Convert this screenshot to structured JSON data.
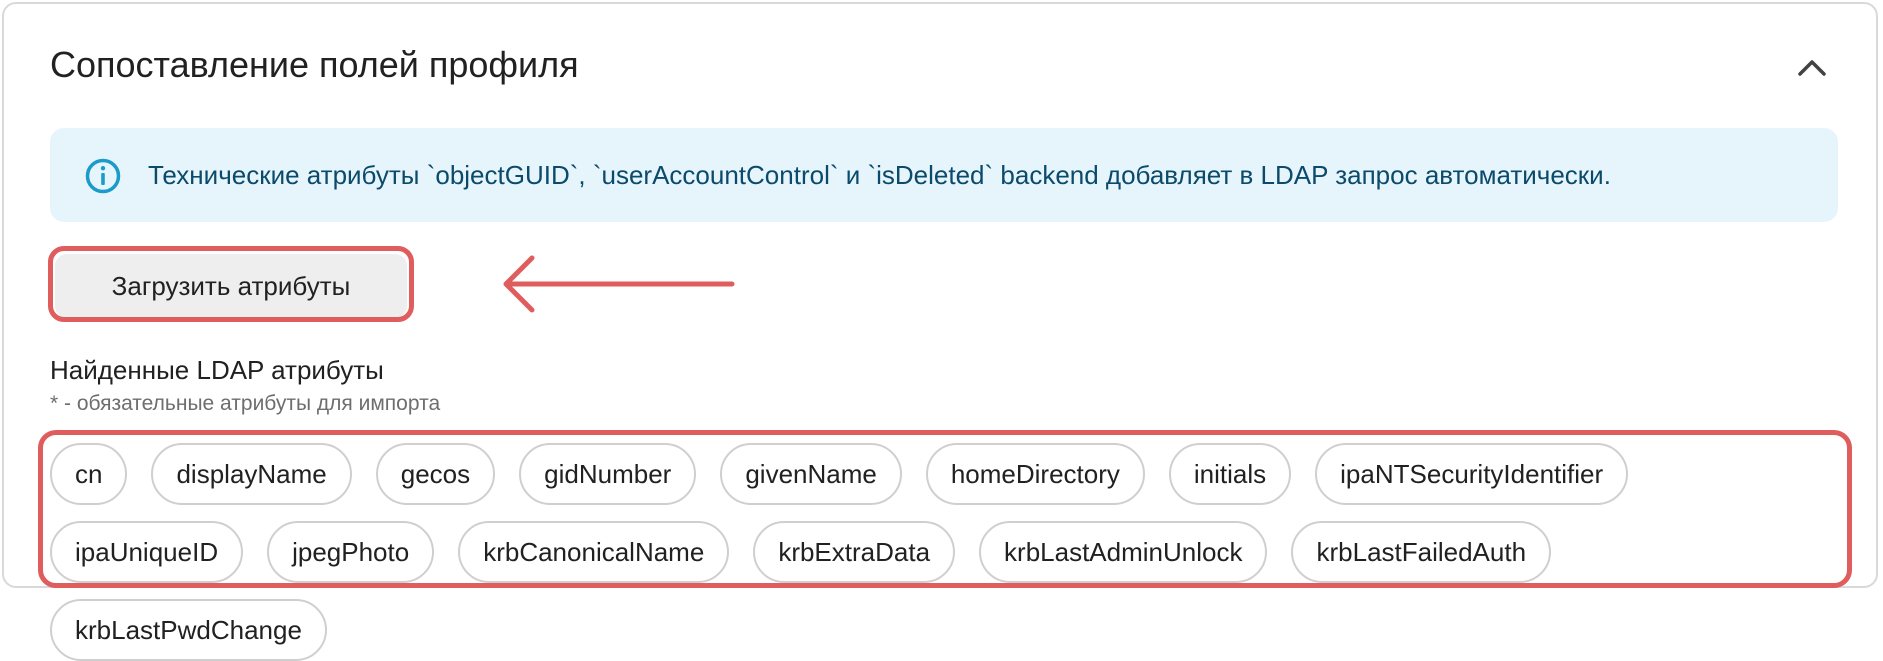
{
  "section": {
    "title": "Сопоставление полей профиля",
    "collapse_icon": "chevron-up-icon"
  },
  "info": {
    "icon": "info-circle-icon",
    "text": "Технические атрибуты `objectGUID`, `userAccountControl` и `isDeleted` backend добавляет в LDAP запрос автоматически."
  },
  "load_button": {
    "label": "Загрузить атрибуты"
  },
  "attributes": {
    "heading": "Найденные LDAP атрибуты",
    "hint": "* - обязательные атрибуты для импорта",
    "chips": [
      "cn",
      "displayName",
      "gecos",
      "gidNumber",
      "givenName",
      "homeDirectory",
      "initials",
      "ipaNTSecurityIdentifier",
      "ipaUniqueID",
      "jpegPhoto",
      "krbCanonicalName",
      "krbExtraData",
      "krbLastAdminUnlock",
      "krbLastFailedAuth",
      "krbLastPwdChange"
    ]
  },
  "colors": {
    "highlight": "#e05d5d",
    "info_bg": "#e6f5fb",
    "info_icon": "#1a9bc9",
    "info_text": "#0b4a6b"
  }
}
